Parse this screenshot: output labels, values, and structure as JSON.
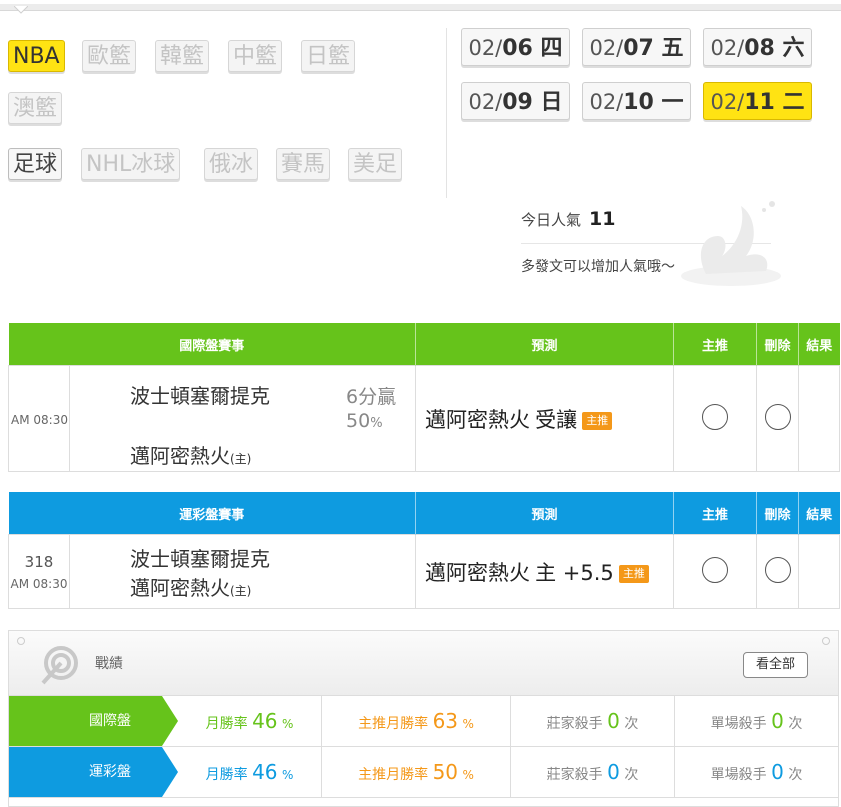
{
  "sports": {
    "row1": [
      "NBA",
      "歐籃",
      "韓籃",
      "中籃",
      "日籃"
    ],
    "row2": [
      "澳籃"
    ],
    "row3": [
      "足球",
      "NHL冰球",
      "俄冰",
      "賽馬",
      "美足"
    ]
  },
  "dates": [
    {
      "prefix": "02/",
      "day": "06 四"
    },
    {
      "prefix": "02/",
      "day": "07 五"
    },
    {
      "prefix": "02/",
      "day": "08 六"
    },
    {
      "prefix": "02/",
      "day": "09 日"
    },
    {
      "prefix": "02/",
      "day": "10 一"
    },
    {
      "prefix": "02/",
      "day": "11 二"
    }
  ],
  "popularity": {
    "label": "今日人氣",
    "value": "11",
    "hint": "多發文可以增加人氣哦～"
  },
  "international": {
    "headers": [
      "國際盤賽事",
      "預測",
      "主推",
      "刪除",
      "結果"
    ],
    "time": "AM 08:30",
    "team1": "波士頓塞爾提克",
    "team2": "邁阿密熱火",
    "home_mark": "(主)",
    "line1": "6分贏",
    "line2": "50",
    "line2_unit": "%",
    "pick": "邁阿密熱火",
    "pick_type": "受讓",
    "badge": "主推"
  },
  "sports_lottery": {
    "headers": [
      "運彩盤賽事",
      "預測",
      "主推",
      "刪除",
      "結果"
    ],
    "game_no": "318",
    "time": "AM 08:30",
    "team1": "波士頓塞爾提克",
    "team2": "邁阿密熱火",
    "home_mark": "(主)",
    "pick": "邁阿密熱火",
    "pick_type": "主 +5.5",
    "badge": "主推"
  },
  "record": {
    "title": "戰績",
    "view_all": "看全部",
    "rows": [
      {
        "name": "國際盤",
        "monthly_label": "月勝率",
        "monthly": "46",
        "main_label": "主推月勝率",
        "main": "63",
        "unit": "%",
        "banker_label": "莊家殺手",
        "banker": "0",
        "single_label": "單場殺手",
        "single": "0",
        "times": "次"
      },
      {
        "name": "運彩盤",
        "monthly_label": "月勝率",
        "monthly": "46",
        "main_label": "主推月勝率",
        "main": "50",
        "unit": "%",
        "banker_label": "莊家殺手",
        "banker": "0",
        "single_label": "單場殺手",
        "single": "0",
        "times": "次"
      }
    ]
  },
  "colors": {
    "green": "#66c31b",
    "blue": "#0e9be0",
    "yellow": "#ffe313",
    "orange": "#f49819"
  }
}
